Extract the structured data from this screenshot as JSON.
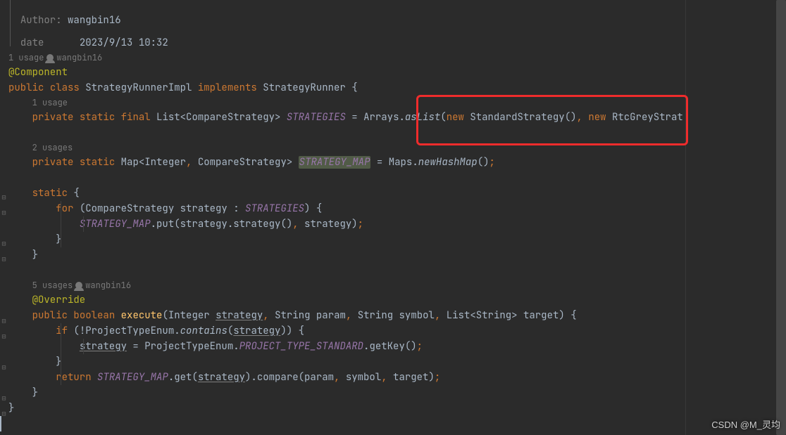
{
  "doc": {
    "author_label": "Author:",
    "author_value": "wangbin16",
    "date_label": "date",
    "date_value": "2023/9/13 10:32"
  },
  "hints": {
    "u1": "1 usage",
    "author1": "wangbin16",
    "u1b": "1 usage",
    "u2": "2 usages",
    "u5": "5 usages",
    "author5": "wangbin16"
  },
  "code": {
    "ann_component": "@Component",
    "kw_public": "public",
    "kw_class": "class",
    "cls_name": "StrategyRunnerImpl",
    "kw_implements": "implements",
    "iface": "StrategyRunner",
    "kw_private": "private",
    "kw_static": "static",
    "kw_final": "final",
    "type_list_cs": "List<CompareStrategy>",
    "field_STRATEGIES": "STRATEGIES",
    "arrays": "Arrays",
    "asList": "asList",
    "kw_new": "new",
    "cls_std": "StandardStrategy",
    "cls_rtc": "RtcGreyStrategy",
    "type_map": "Map<Integer",
    "type_map2": " CompareStrategy>",
    "field_STRATEGY_MAP": "STRATEGY_MAP",
    "maps": "Maps",
    "newHashMap": "newHashMap",
    "kw_for": "for",
    "cs": "CompareStrategy",
    "var_strategy": "strategy",
    "put": ".put(strategy.strategy()",
    "put2": " strategy)",
    "ann_override": "@Override",
    "kw_boolean": "boolean",
    "m_execute": "execute",
    "p_integer": "Integer",
    "p_strategy": "strategy",
    "p_string": "String",
    "p_param": "param",
    "p_symbol": "symbol",
    "p_liststr": "List<String>",
    "p_target": "target",
    "kw_if": "if",
    "pte": "ProjectTypeEnum",
    "contains": "contains",
    "assign_strategy": "strategy",
    "pte2": "ProjectTypeEnum",
    "const_ptstd": "PROJECT_TYPE_STANDARD",
    "getkey": ".getKey()",
    "kw_return": "return",
    "sm2": "STRATEGY_MAP",
    "get": ".get(",
    "compare": ").compare(param",
    "compare2": " symbol",
    "compare3": " target)"
  },
  "watermark": "CSDN @M_灵均"
}
